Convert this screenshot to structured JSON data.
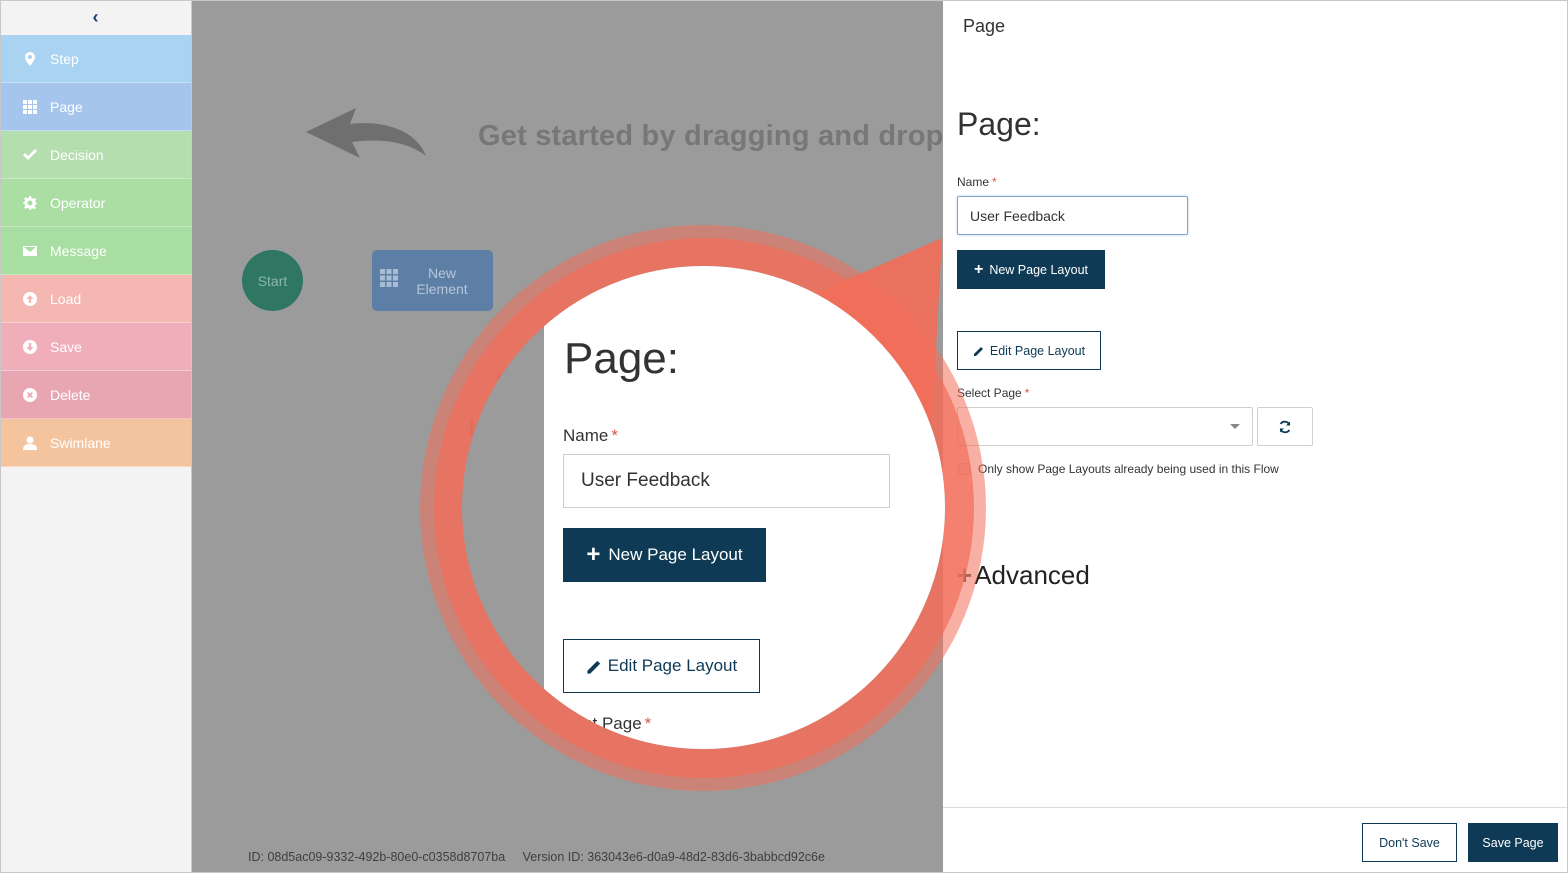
{
  "sidebar": {
    "collapse_icon": "chevron-left-icon",
    "items": [
      {
        "label": "Step",
        "icon": "map-marker-icon",
        "color": "#a9d3f1"
      },
      {
        "label": "Page",
        "icon": "grid-icon",
        "color": "#a5c5ec"
      },
      {
        "label": "Decision",
        "icon": "checkmark-icon",
        "color": "#b4deae"
      },
      {
        "label": "Operator",
        "icon": "gear-icon",
        "color": "#aadea3"
      },
      {
        "label": "Message",
        "icon": "envelope-icon",
        "color": "#a8dea1"
      },
      {
        "label": "Load",
        "icon": "upload-icon",
        "color": "#f5b7b1"
      },
      {
        "label": "Save",
        "icon": "download-icon",
        "color": "#efaeba"
      },
      {
        "label": "Delete",
        "icon": "circle-x-icon",
        "color": "#e8a6b3"
      },
      {
        "label": "Swimlane",
        "icon": "user-icon",
        "color": "#f4c49f"
      }
    ]
  },
  "canvas": {
    "hint_text": "Get started by dragging and droppi",
    "start_node_label": "Start",
    "new_element_label": "New Element",
    "ghost_text_1": "art",
    "ghost_text_2": "I",
    "flow_id": "ID: 08d5ac09-9332-492b-80e0-c0358d8707ba",
    "version_id": "Version ID: 363043e6-d0a9-48d2-83d6-3babbcd92c6e"
  },
  "panel": {
    "header": "Page",
    "title": "Page:",
    "name_label": "Name",
    "required_mark": "*",
    "name_value": "User Feedback",
    "new_layout_button": "New Page Layout",
    "edit_layout_button": "Edit Page Layout",
    "select_page_label": "Select Page",
    "select_page_value": "",
    "checkbox_label": "Only show Page Layouts already being used in this Flow",
    "advanced_label": "Advanced",
    "dont_save_button": "Don't Save",
    "save_button": "Save Page"
  },
  "callout": {
    "title": "Page:",
    "name_label": "Name",
    "name_value": "User Feedback",
    "new_layout_button": "New Page Layout",
    "edit_layout_button": "Edit Page Layout",
    "select_page_label": "ct Page",
    "ring_color": "#f26e5a"
  },
  "colors": {
    "primary": "#0e3a55",
    "required": "#d9534f",
    "canvas_overlay": "#9b9b9b"
  }
}
